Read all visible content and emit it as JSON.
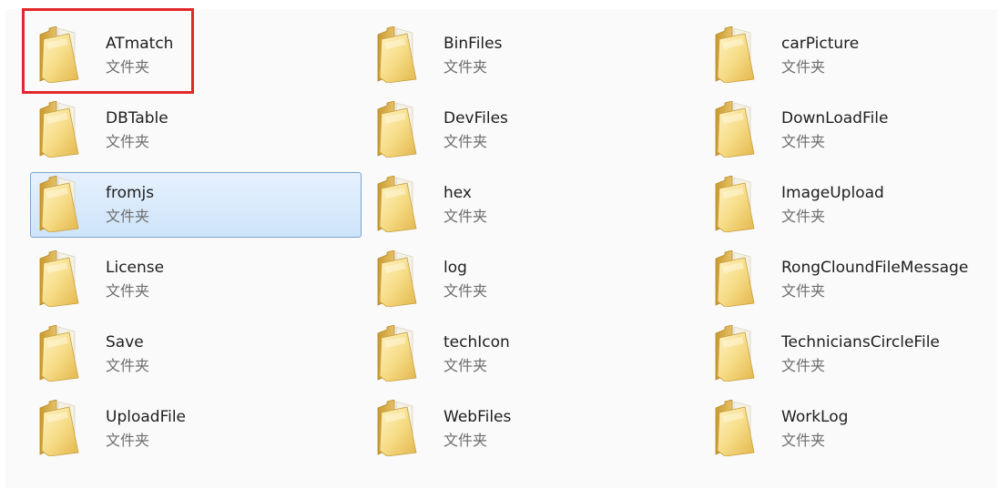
{
  "folders": [
    {
      "name": "ATmatch",
      "type": "文件夹"
    },
    {
      "name": "BinFiles",
      "type": "文件夹"
    },
    {
      "name": "carPicture",
      "type": "文件夹"
    },
    {
      "name": "DBTable",
      "type": "文件夹"
    },
    {
      "name": "DevFiles",
      "type": "文件夹"
    },
    {
      "name": "DownLoadFile",
      "type": "文件夹"
    },
    {
      "name": "fromjs",
      "type": "文件夹",
      "selected": true
    },
    {
      "name": "hex",
      "type": "文件夹"
    },
    {
      "name": "ImageUpload",
      "type": "文件夹"
    },
    {
      "name": "License",
      "type": "文件夹"
    },
    {
      "name": "log",
      "type": "文件夹"
    },
    {
      "name": "RongCloundFileMessage",
      "type": "文件夹"
    },
    {
      "name": "Save",
      "type": "文件夹"
    },
    {
      "name": "techIcon",
      "type": "文件夹"
    },
    {
      "name": "TechniciansCircleFile",
      "type": "文件夹"
    },
    {
      "name": "UploadFile",
      "type": "文件夹"
    },
    {
      "name": "WebFiles",
      "type": "文件夹"
    },
    {
      "name": "WorkLog",
      "type": "文件夹"
    }
  ],
  "annotation": {
    "highlighted_item": "ATmatch",
    "color": "#e3262a"
  },
  "colors": {
    "selection_fill": "#cde4fa",
    "selection_border": "#7da2ce"
  }
}
